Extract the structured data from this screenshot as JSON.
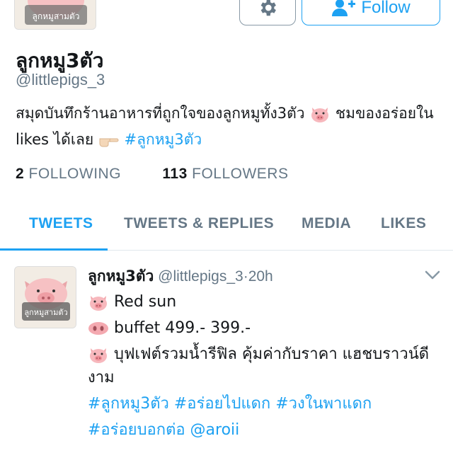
{
  "profile": {
    "display_name": "ลูกหมู3ตัว",
    "handle": "@littlepigs_3",
    "bio_text": "สมุดบันทึกร้านอาหารที่ถูกใจของลูกหมูทั้ง3ตัว",
    "bio_text2": " ชมของอร่อยใน likes ได้เลย ",
    "bio_hashtag": "#ลูกหมู3ตัว",
    "avatar_caption": "ลูกหมูสามตัว"
  },
  "buttons": {
    "follow_label": "Follow",
    "settings_icon": "gear-icon"
  },
  "stats": {
    "following_count": "2",
    "following_label": "FOLLOWING",
    "followers_count": "113",
    "followers_label": "FOLLOWERS"
  },
  "tabs": [
    {
      "label": "TWEETS",
      "active": true
    },
    {
      "label": "TWEETS & REPLIES",
      "active": false
    },
    {
      "label": "MEDIA",
      "active": false
    },
    {
      "label": "LIKES",
      "active": false
    }
  ],
  "tweet": {
    "name": "ลูกหมู3ตัว",
    "handle": "@littlepigs_3",
    "separator": "·",
    "time": "20h",
    "line1": "Red sun",
    "line2": "buffet 499.- 399.-",
    "line3": "บุฟเฟต์รวมน้ำรีฟิล คุ้มค่ากับราคา แฮชบราวน์ดีงาม",
    "hashtags_line1": "#ลูกหมู3ตัว #อร่อยไปแดก #วงในพาแดก",
    "hashtags_line2": "#อร่อยบอกต่อ @aroii"
  },
  "colors": {
    "accent": "#1da1f2",
    "secondary_text": "#657786",
    "primary_text": "#14171a"
  }
}
